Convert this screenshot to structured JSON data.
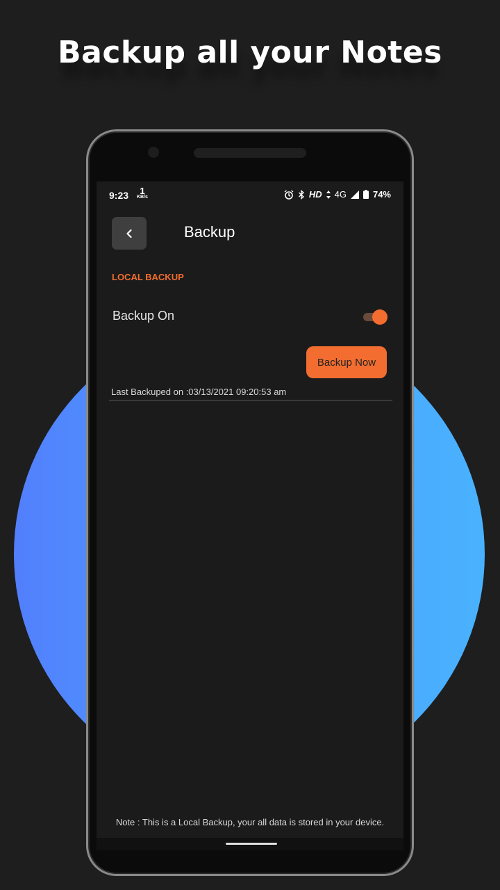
{
  "promo": {
    "headline": "Backup all your Notes"
  },
  "status_bar": {
    "time": "9:23",
    "speed_value": "1",
    "speed_unit": "KB/s",
    "network_hd": "HD",
    "network_type": "4G",
    "battery": "74%",
    "icons": [
      "alarm-icon",
      "bluetooth-icon",
      "signal-icon",
      "battery-icon"
    ]
  },
  "header": {
    "title": "Backup",
    "back_icon": "chevron-left-icon"
  },
  "local_backup": {
    "section_label": "LOCAL BACKUP",
    "toggle_label": "Backup On",
    "toggle_on": true,
    "backup_now_label": "Backup Now",
    "last_backup_text": "Last Backuped on :03/13/2021 09:20:53 am"
  },
  "footer": {
    "note": "Note : This is a Local Backup, your all data is stored in your device."
  },
  "colors": {
    "accent": "#f26d2f",
    "background": "#1e1e1e",
    "screen": "#1b1b1b",
    "circle_left": "#527ffd",
    "circle_right": "#49b2fe"
  }
}
